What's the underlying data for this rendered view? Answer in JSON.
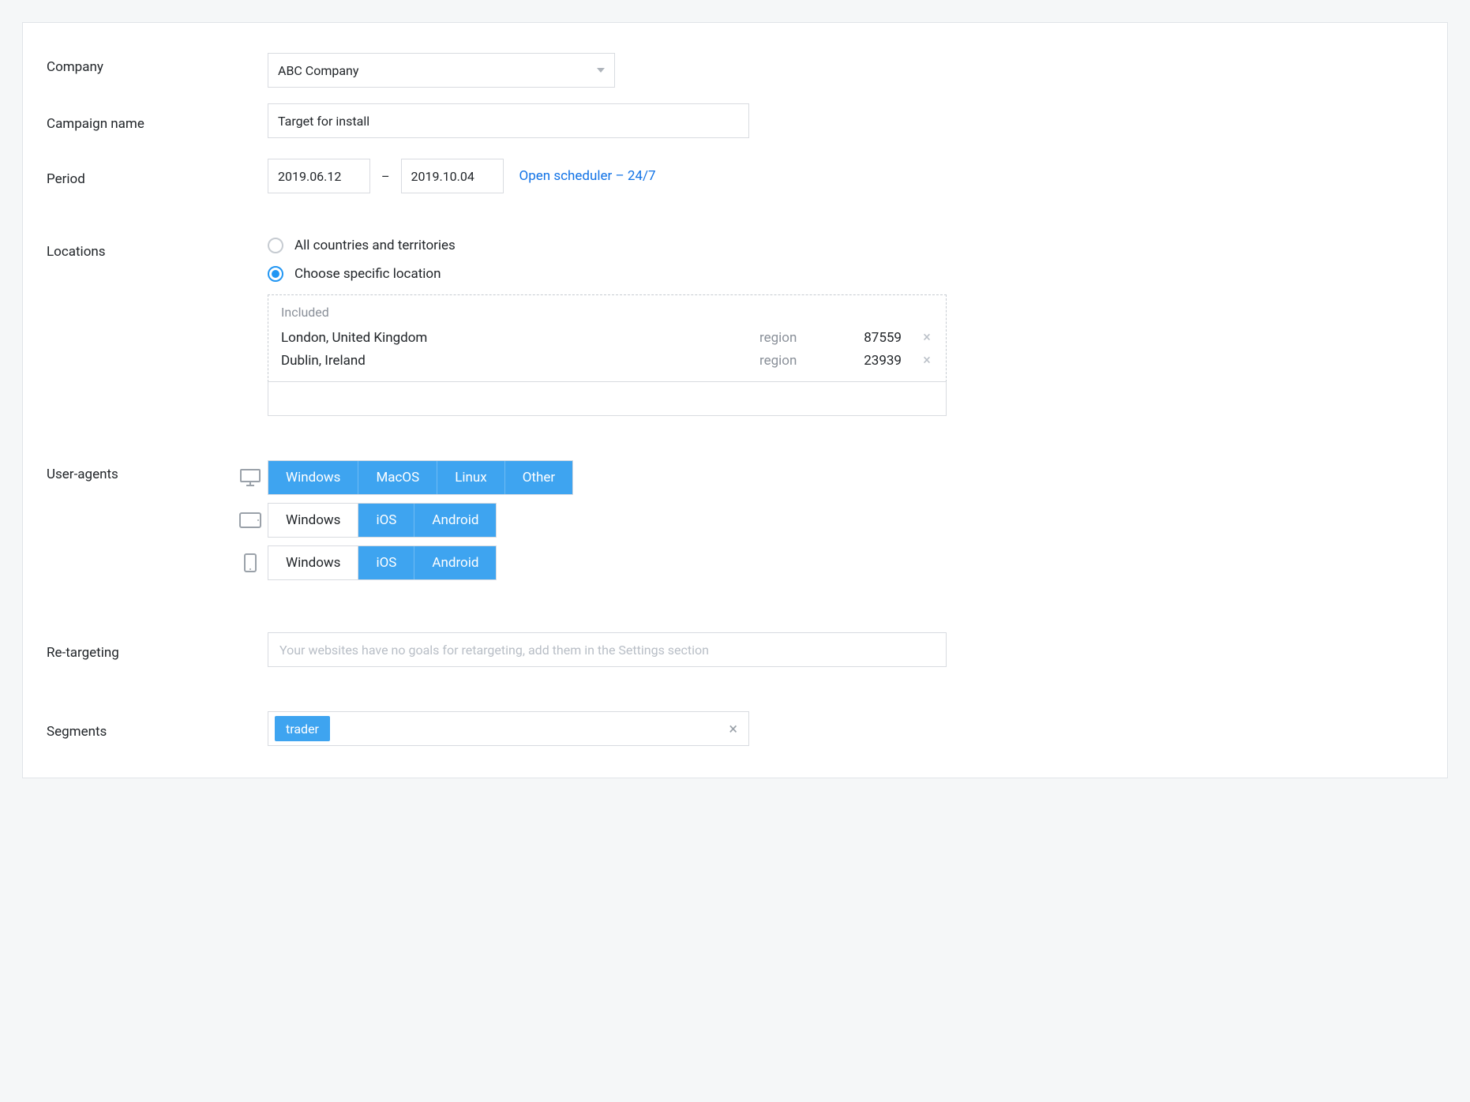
{
  "labels": {
    "company": "Company",
    "campaign_name": "Campaign name",
    "period": "Period",
    "locations": "Locations",
    "user_agents": "User-agents",
    "retargeting": "Re-targeting",
    "segments": "Segments"
  },
  "company": {
    "selected": "ABC Company"
  },
  "campaign": {
    "name": "Target for install"
  },
  "period": {
    "from": "2019.06.12",
    "to": "2019.10.04",
    "separator": "–",
    "scheduler_link": "Open scheduler – 24/7"
  },
  "locations": {
    "options": {
      "all": "All countries and territories",
      "specific": "Choose specific location"
    },
    "selected": "specific",
    "included_label": "Included",
    "included": [
      {
        "name": "London, United Kingdom",
        "type": "region",
        "count": "87559"
      },
      {
        "name": "Dublin, Ireland",
        "type": "region",
        "count": "23939"
      }
    ]
  },
  "user_agents": {
    "desktop": [
      {
        "label": "Windows",
        "on": true
      },
      {
        "label": "MacOS",
        "on": true
      },
      {
        "label": "Linux",
        "on": true
      },
      {
        "label": "Other",
        "on": true
      }
    ],
    "tablet": [
      {
        "label": "Windows",
        "on": false
      },
      {
        "label": "iOS",
        "on": true
      },
      {
        "label": "Android",
        "on": true
      }
    ],
    "mobile": [
      {
        "label": "Windows",
        "on": false
      },
      {
        "label": "iOS",
        "on": true
      },
      {
        "label": "Android",
        "on": true
      }
    ]
  },
  "retargeting": {
    "placeholder": "Your websites have no goals for retargeting, add them in the Settings section"
  },
  "segments": {
    "tags": [
      "trader"
    ]
  }
}
